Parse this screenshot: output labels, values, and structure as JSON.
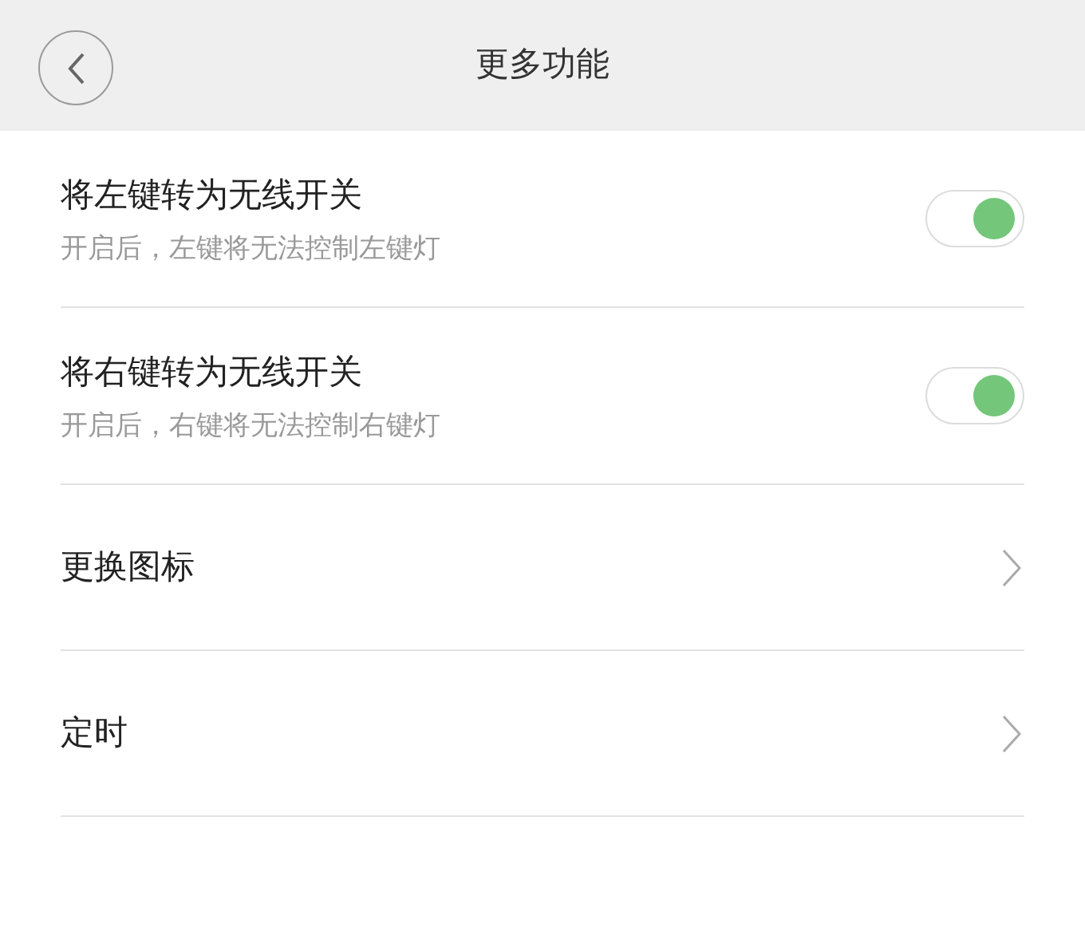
{
  "header": {
    "title": "更多功能"
  },
  "items": [
    {
      "kind": "toggle",
      "title": "将左键转为无线开关",
      "subtitle": "开启后，左键将无法控制左键灯",
      "on": true
    },
    {
      "kind": "toggle",
      "title": "将右键转为无线开关",
      "subtitle": "开启后，右键将无法控制右键灯",
      "on": true
    },
    {
      "kind": "link",
      "title": "更换图标"
    },
    {
      "kind": "link",
      "title": "定时"
    }
  ]
}
